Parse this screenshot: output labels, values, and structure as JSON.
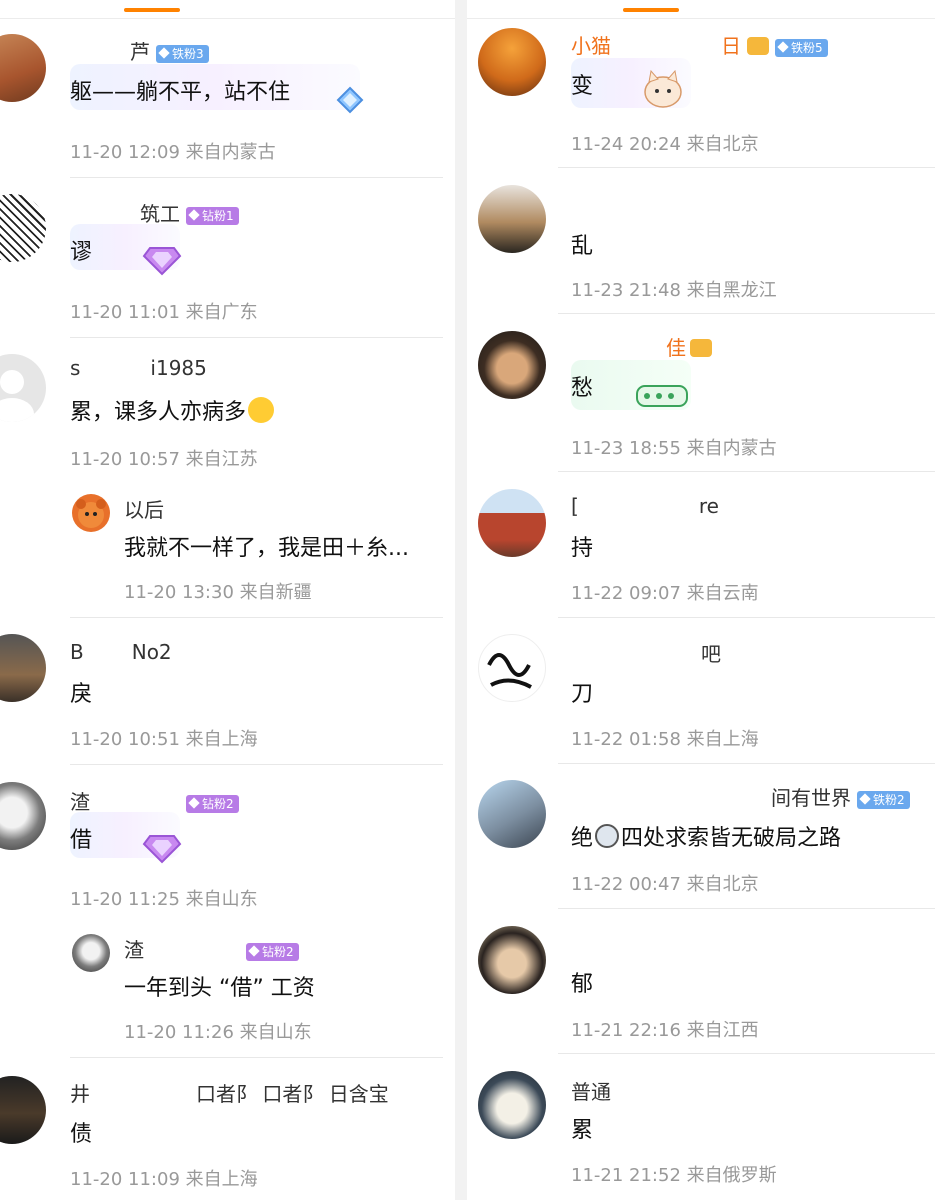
{
  "left": {
    "comments": [
      {
        "name": "芦",
        "badge": "铁粉3",
        "text": "躯——躺不平，站不住",
        "time": "11-20 12:09",
        "loc": "来自内蒙古"
      },
      {
        "name": "筑工",
        "badge": "钻粉1",
        "text": "谬",
        "time": "11-20 11:01",
        "loc": "来自广东"
      },
      {
        "name_a": "s",
        "name_b": "i1985",
        "text": "累，课多人亦病多",
        "time": "11-20 10:57",
        "loc": "来自江苏",
        "reply": {
          "name": "以后",
          "text": "我就不一样了，我是田＋糸...",
          "time": "11-20 13:30",
          "loc": "来自新疆"
        }
      },
      {
        "name_a": "B",
        "name_b": "No2",
        "text": "戾",
        "time": "11-20 10:51",
        "loc": "来自上海"
      },
      {
        "name": "渣",
        "badge": "钻粉2",
        "text": "借",
        "time": "11-20 11:25",
        "loc": "来自山东",
        "reply": {
          "name": "渣",
          "badge": "钻粉2",
          "text": "一年到头 “借” 工资",
          "time": "11-20 11:26",
          "loc": "来自山东"
        }
      },
      {
        "name_a": "井",
        "name_b": "口者阝 口者阝 日含宝",
        "text": "债",
        "time": "11-20 11:09",
        "loc": "来自上海"
      }
    ]
  },
  "right": {
    "comments": [
      {
        "name_a": "小猫",
        "name_b": "日",
        "badge": "铁粉5",
        "text": "变",
        "time": "11-24 20:24",
        "loc": "来自北京"
      },
      {
        "name": "",
        "text": "乱",
        "time": "11-23 21:48",
        "loc": "来自黑龙江"
      },
      {
        "name": "佳",
        "text": "愁",
        "time": "11-23 18:55",
        "loc": "来自内蒙古"
      },
      {
        "name_a": "[",
        "name_b": "re",
        "text": "持",
        "time": "11-22 09:07",
        "loc": "来自云南"
      },
      {
        "name": "吧",
        "text": "刀",
        "time": "11-22 01:58",
        "loc": "来自上海"
      },
      {
        "name": "间有世界",
        "badge": "铁粉2",
        "text": "绝",
        "text2": "四处求索皆无破局之路",
        "time": "11-22 00:47",
        "loc": "来自北京"
      },
      {
        "name": "",
        "text": "郁",
        "time": "11-21 22:16",
        "loc": "来自江西"
      },
      {
        "name": "普通",
        "text": "累",
        "time": "11-21 21:52",
        "loc": "来自俄罗斯"
      }
    ]
  },
  "colors": {
    "accent": "#ff8200",
    "name_orange": "#f0721c",
    "meta": "#999999",
    "iron_badge": "#6aa8ee",
    "diamond_badge": "#b77be6"
  }
}
